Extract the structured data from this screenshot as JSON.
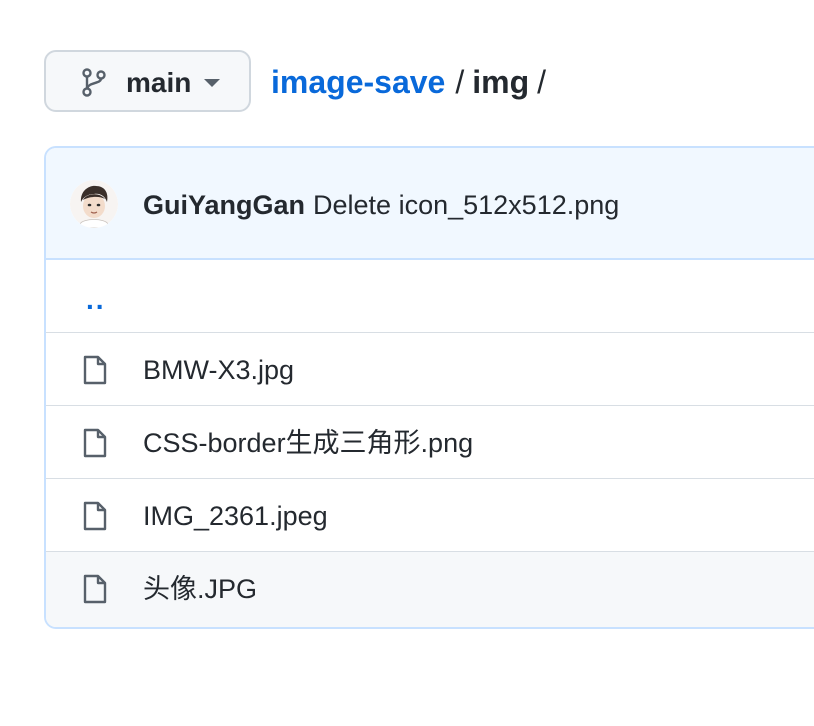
{
  "branch": {
    "name": "main",
    "icon": "git-branch-icon"
  },
  "breadcrumb": {
    "repo": "image-save",
    "separator": "/",
    "folder": "img",
    "trailing_separator": "/"
  },
  "commit": {
    "author": "GuiYangGan",
    "message": "Delete icon_512x512.png"
  },
  "parent_link": "..",
  "files": [
    {
      "name": "BMW-X3.jpg",
      "icon": "file-icon"
    },
    {
      "name": "CSS-border生成三角形.png",
      "icon": "file-icon"
    },
    {
      "name": "IMG_2361.jpeg",
      "icon": "file-icon"
    },
    {
      "name": "头像.JPG",
      "icon": "file-icon"
    }
  ],
  "colors": {
    "link": "#0969da",
    "text": "#24292f",
    "header_bg": "#f1f8ff",
    "border": "#d0d7de"
  }
}
